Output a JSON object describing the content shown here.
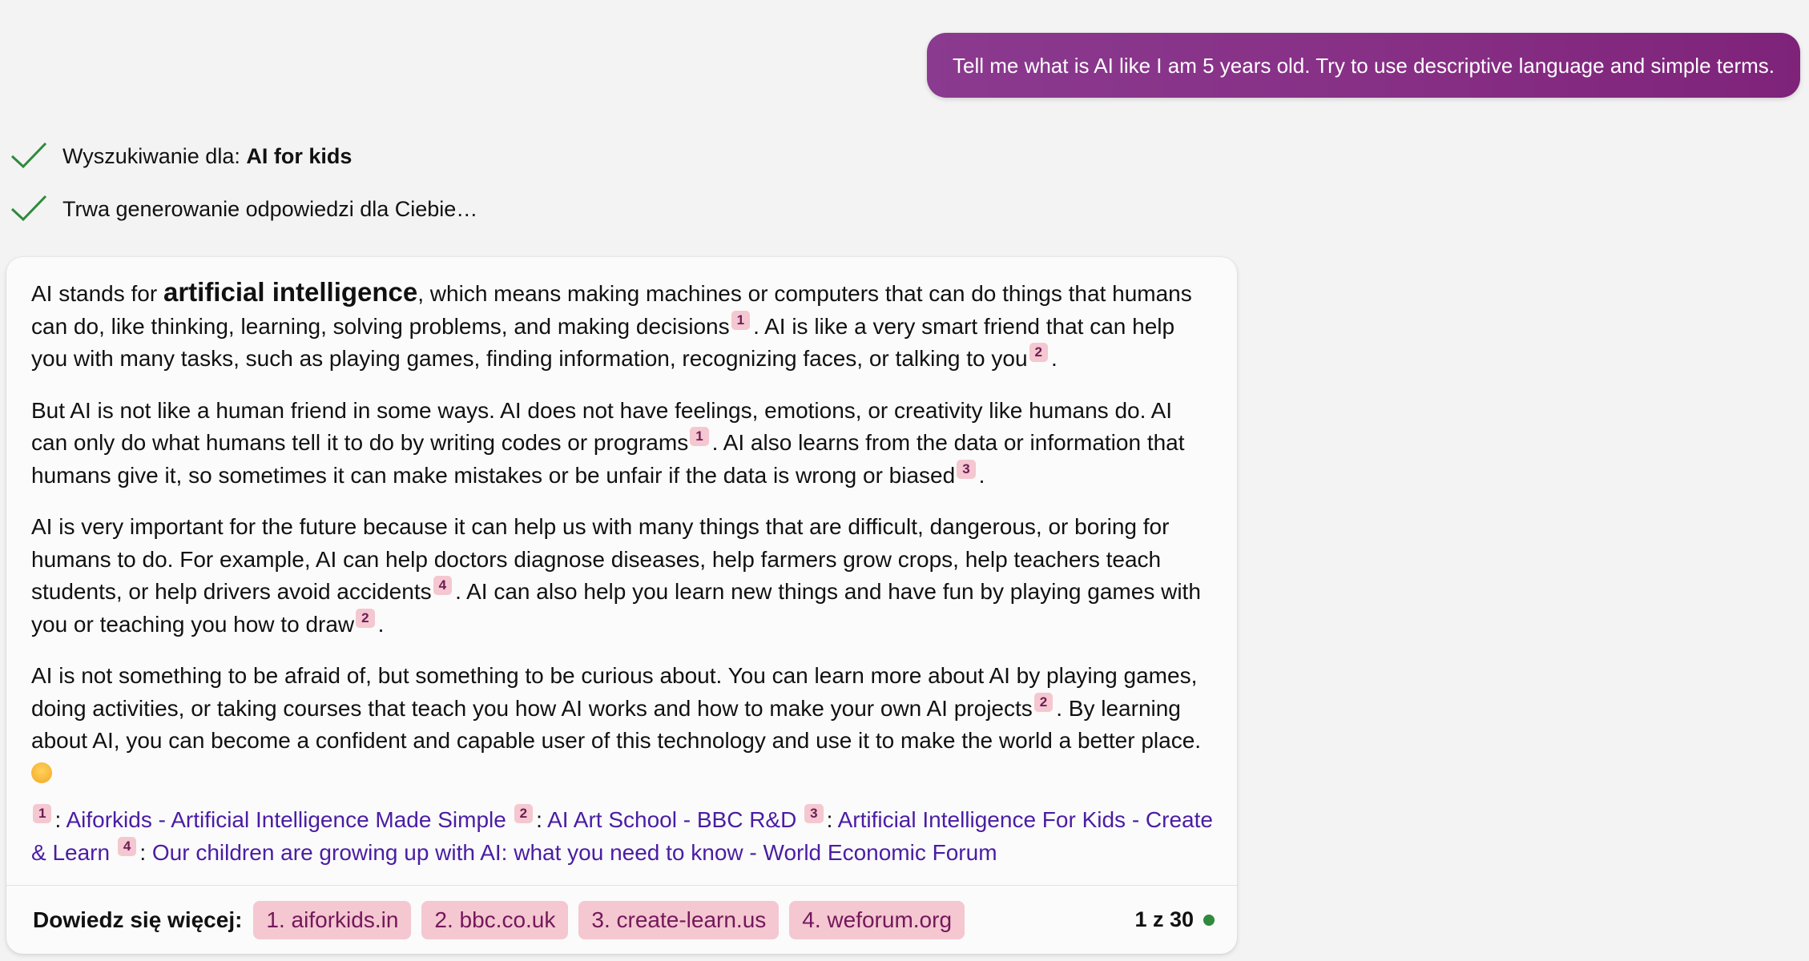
{
  "user_message": "Tell me what is AI like I am 5 years old. Try to use descriptive language and simple terms.",
  "status": {
    "search_prefix": "Wyszukiwanie dla: ",
    "search_query": "AI for kids",
    "generating": "Trwa generowanie odpowiedzi dla Ciebie…"
  },
  "answer": {
    "p1": {
      "a": "AI stands for ",
      "b": "artificial intelligence",
      "c": ", which means making machines or computers that can do things that humans can do, like thinking, learning, solving problems, and making decisions",
      "c1": "1",
      "d": ". AI is like a very smart friend that can help you with many tasks, such as playing games, finding information, recognizing faces, or talking to you",
      "c2": "2",
      "e": "."
    },
    "p2": {
      "a": "But AI is not like a human friend in some ways. AI does not have feelings, emotions, or creativity like humans do. AI can only do what humans tell it to do by writing codes or programs",
      "c1": "1",
      "b": ". AI also learns from the data or information that humans give it, so sometimes it can make mistakes or be unfair if the data is wrong or biased",
      "c2": "3",
      "c": "."
    },
    "p3": {
      "a": "AI is very important for the future because it can help us with many things that are difficult, dangerous, or boring for humans to do. For example, AI can help doctors diagnose diseases, help farmers grow crops, help teachers teach students, or help drivers avoid accidents",
      "c1": "4",
      "b": ". AI can also help you learn new things and have fun by playing games with you or teaching you how to draw",
      "c2": "2",
      "c": "."
    },
    "p4": {
      "a": "AI is not something to be afraid of, but something to be curious about. You can learn more about AI by playing games, doing activities, or taking courses that teach you how AI works and how to make your own AI projects",
      "c1": "2",
      "b": ". By learning about AI, you can become a confident and capable user of this technology and use it to make the world a better place."
    }
  },
  "references": [
    {
      "num": "1",
      "text": "Aiforkids - Artificial Intelligence Made Simple"
    },
    {
      "num": "2",
      "text": "AI Art School - BBC R&D"
    },
    {
      "num": "3",
      "text": "Artificial Intelligence For Kids - Create & Learn"
    },
    {
      "num": "4",
      "text": "Our children are growing up with AI: what you need to know - World Economic Forum"
    }
  ],
  "footer": {
    "label": "Dowiedz się więcej:",
    "sources": [
      "1. aiforkids.in",
      "2. bbc.co.uk",
      "3. create-learn.us",
      "4. weforum.org"
    ],
    "count": "1 z 30"
  },
  "colors": {
    "accent": "#862e84",
    "citation_bg": "#f4c7d1",
    "link": "#4a1da3",
    "status_ok": "#2f8a3b"
  }
}
